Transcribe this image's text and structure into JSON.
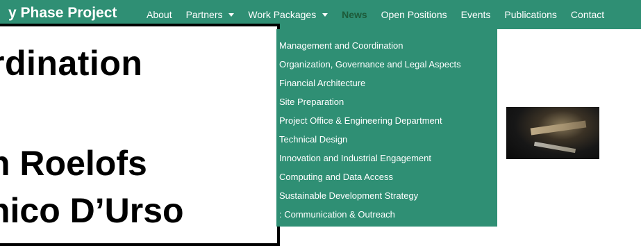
{
  "navbar": {
    "brand": "y Phase Project",
    "items": [
      {
        "label": "About"
      },
      {
        "label": "Partners",
        "dropdown": true
      },
      {
        "label": "Work Packages",
        "dropdown": true
      },
      {
        "label": "News",
        "active": true
      },
      {
        "label": "Open Positions"
      },
      {
        "label": "Events"
      },
      {
        "label": "Publications"
      },
      {
        "label": "Contact"
      }
    ]
  },
  "dropdown": {
    "items": [
      "Management and Coordination",
      "Organization, Governance and Legal Aspects",
      "Financial Architecture",
      "Site Preparation",
      "Project Office & Engineering Department",
      "Technical Design",
      "Innovation and Industrial Engagement",
      "Computing and Data Access",
      "Sustainable Development Strategy",
      ": Communication & Outreach"
    ]
  },
  "slide": {
    "line1": "ordination",
    "line2": "n Roelofs",
    "line3": "nico D’Urso"
  },
  "thumbnail": {
    "icon": "image-thumbnail"
  },
  "colors": {
    "navbar_bg": "#2f8f74",
    "dropdown_bg": "#2f8f74",
    "active_text": "#1d5b3a",
    "text_on_green": "#ffffff"
  }
}
